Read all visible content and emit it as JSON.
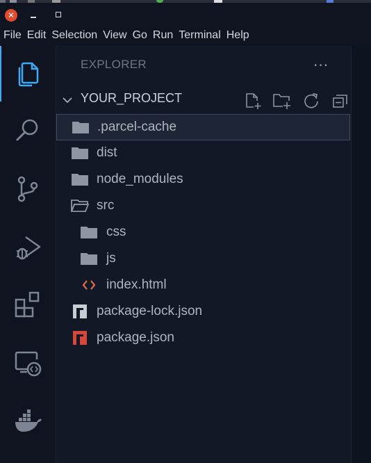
{
  "window": {
    "close_glyph": "✕"
  },
  "menubar": {
    "items": [
      "File",
      "Edit",
      "Selection",
      "View",
      "Go",
      "Run",
      "Terminal",
      "Help"
    ]
  },
  "activity_bar": {
    "items": [
      {
        "icon": "files-icon",
        "active": true
      },
      {
        "icon": "search-icon",
        "active": false
      },
      {
        "icon": "source-control-icon",
        "active": false
      },
      {
        "icon": "run-debug-icon",
        "active": false
      },
      {
        "icon": "extensions-icon",
        "active": false
      },
      {
        "icon": "remote-explorer-icon",
        "active": false
      },
      {
        "icon": "docker-icon",
        "active": false
      }
    ],
    "accent": "#3fa9f5"
  },
  "explorer": {
    "title": "EXPLORER",
    "more": "...",
    "project_name": "YOUR_PROJECT",
    "actions": [
      "new-file-icon",
      "new-folder-icon",
      "refresh-icon",
      "collapse-all-icon"
    ],
    "tree": [
      {
        "label": ".parcel-cache",
        "type": "folder",
        "depth": 0,
        "selected": true
      },
      {
        "label": "dist",
        "type": "folder",
        "depth": 0
      },
      {
        "label": "node_modules",
        "type": "folder",
        "depth": 0
      },
      {
        "label": "src",
        "type": "folder-open",
        "depth": 0
      },
      {
        "label": "css",
        "type": "folder",
        "depth": 1
      },
      {
        "label": "js",
        "type": "folder",
        "depth": 1
      },
      {
        "label": "index.html",
        "type": "html",
        "depth": 1
      },
      {
        "label": "package-lock.json",
        "type": "npm-lock",
        "depth": 0
      },
      {
        "label": "package.json",
        "type": "npm",
        "depth": 0
      }
    ]
  },
  "colors": {
    "background": "#0f1420",
    "sidebar": "#121826",
    "selection": "#1e2636",
    "html_icon": "#e06b4a",
    "npm_icon": "#d9463a",
    "npm_lock_icon": "#c9ced6"
  }
}
